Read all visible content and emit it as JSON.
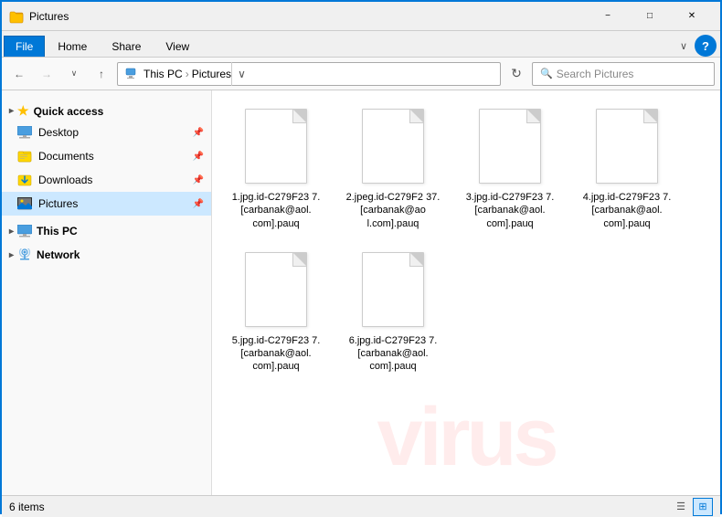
{
  "titlebar": {
    "title": "Pictures",
    "minimize_label": "−",
    "maximize_label": "□",
    "close_label": "✕"
  },
  "ribbon": {
    "tabs": [
      "File",
      "Home",
      "Share",
      "View"
    ],
    "active_tab": "File",
    "chevron_label": "∨",
    "help_label": "?"
  },
  "addressbar": {
    "back_label": "←",
    "forward_label": "→",
    "dropdown_label": "∨",
    "up_label": "↑",
    "path_icon": "📁",
    "path_parts": [
      "This PC",
      "Pictures"
    ],
    "path_separator": "›",
    "refresh_label": "↻",
    "search_placeholder": "Search Pictures",
    "search_icon": "🔍"
  },
  "sidebar": {
    "quick_access_label": "Quick access",
    "items": [
      {
        "name": "Desktop",
        "pin": true
      },
      {
        "name": "Documents",
        "pin": true
      },
      {
        "name": "Downloads",
        "pin": true
      },
      {
        "name": "Pictures",
        "pin": true,
        "active": true
      }
    ],
    "this_pc_label": "This PC",
    "network_label": "Network"
  },
  "files": [
    {
      "name": "1.jpg.id-C279F23 7.[carbanak@aol. com].pauq"
    },
    {
      "name": "2.jpeg.id-C279F2 37.[carbanak@ao l.com].pauq"
    },
    {
      "name": "3.jpg.id-C279F23 7.[carbanak@aol. com].pauq"
    },
    {
      "name": "4.jpg.id-C279F23 7.[carbanak@aol. com].pauq"
    },
    {
      "name": "5.jpg.id-C279F23 7.[carbanak@aol. com].pauq"
    },
    {
      "name": "6.jpg.id-C279F23 7.[carbanak@aol. com].pauq"
    }
  ],
  "statusbar": {
    "item_count": "6 items",
    "view_list_label": "☰",
    "view_grid_label": "⊞"
  },
  "watermark": "virus"
}
